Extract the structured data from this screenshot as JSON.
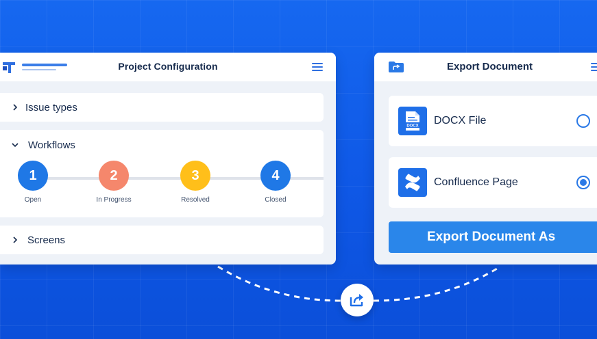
{
  "project_panel": {
    "title": "Project Configuration",
    "sections": {
      "issue_types": "Issue types",
      "workflows": "Workflows",
      "screens": "Screens"
    },
    "workflow_steps": [
      {
        "number": "1",
        "label": "Open",
        "color": "#1f78e6"
      },
      {
        "number": "2",
        "label": "In Progress",
        "color": "#f5876c"
      },
      {
        "number": "3",
        "label": "Resolved",
        "color": "#ffbf1a"
      },
      {
        "number": "4",
        "label": "Closed",
        "color": "#1f78e6"
      }
    ]
  },
  "export_panel": {
    "title": "Export Document",
    "options": [
      {
        "label": "DOCX File",
        "icon": "docx-file-icon",
        "badge": "DOCX",
        "selected": false
      },
      {
        "label": "Confluence Page",
        "icon": "confluence-icon",
        "selected": true
      }
    ],
    "export_button": "Export Document As"
  },
  "colors": {
    "background": "#1264ee",
    "accent": "#2a86ea",
    "text_dark": "#172b4d"
  }
}
